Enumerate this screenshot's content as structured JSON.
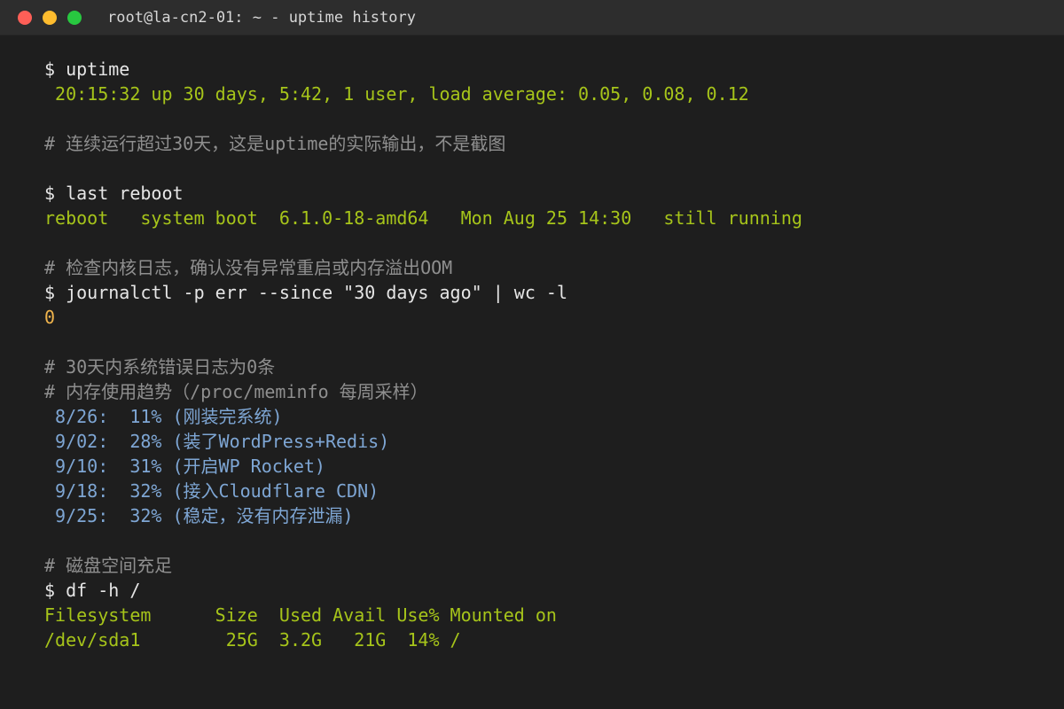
{
  "window": {
    "title": "root@la-cn2-01: ~ - uptime history",
    "colors": {
      "close": "#fe5f57",
      "minimize": "#febc2e",
      "zoom": "#28c840"
    }
  },
  "terminal": {
    "lines": [
      {
        "kind": "cmd",
        "text": "$ uptime"
      },
      {
        "kind": "out",
        "text": " 20:15:32 up 30 days, 5:42, 1 user, load average: 0.05, 0.08, 0.12"
      },
      {
        "kind": "blank",
        "text": ""
      },
      {
        "kind": "comment",
        "text": "# 连续运行超过30天，这是uptime的实际输出，不是截图"
      },
      {
        "kind": "blank",
        "text": ""
      },
      {
        "kind": "cmd",
        "text": "$ last reboot"
      },
      {
        "kind": "out",
        "text": "reboot   system boot  6.1.0-18-amd64   Mon Aug 25 14:30   still running"
      },
      {
        "kind": "blank",
        "text": ""
      },
      {
        "kind": "comment",
        "text": "# 检查内核日志，确认没有异常重启或内存溢出OOM"
      },
      {
        "kind": "cmd",
        "text": "$ journalctl -p err --since \"30 days ago\" | wc -l"
      },
      {
        "kind": "num",
        "text": "0"
      },
      {
        "kind": "blank",
        "text": ""
      },
      {
        "kind": "comment",
        "text": "# 30天内系统错误日志为0条"
      },
      {
        "kind": "comment",
        "text": "# 内存使用趋势（/proc/meminfo 每周采样）"
      },
      {
        "kind": "mem",
        "text": " 8/26:  11% (刚装完系统)"
      },
      {
        "kind": "mem",
        "text": " 9/02:  28% (装了WordPress+Redis)"
      },
      {
        "kind": "mem",
        "text": " 9/10:  31% (开启WP Rocket)"
      },
      {
        "kind": "mem",
        "text": " 9/18:  32% (接入Cloudflare CDN)"
      },
      {
        "kind": "mem",
        "text": " 9/25:  32% (稳定，没有内存泄漏)"
      },
      {
        "kind": "blank",
        "text": ""
      },
      {
        "kind": "comment",
        "text": "# 磁盘空间充足"
      },
      {
        "kind": "cmd",
        "text": "$ df -h /"
      },
      {
        "kind": "out",
        "text": "Filesystem      Size  Used Avail Use% Mounted on"
      },
      {
        "kind": "out",
        "text": "/dev/sda1        25G  3.2G   21G  14% /"
      }
    ]
  }
}
